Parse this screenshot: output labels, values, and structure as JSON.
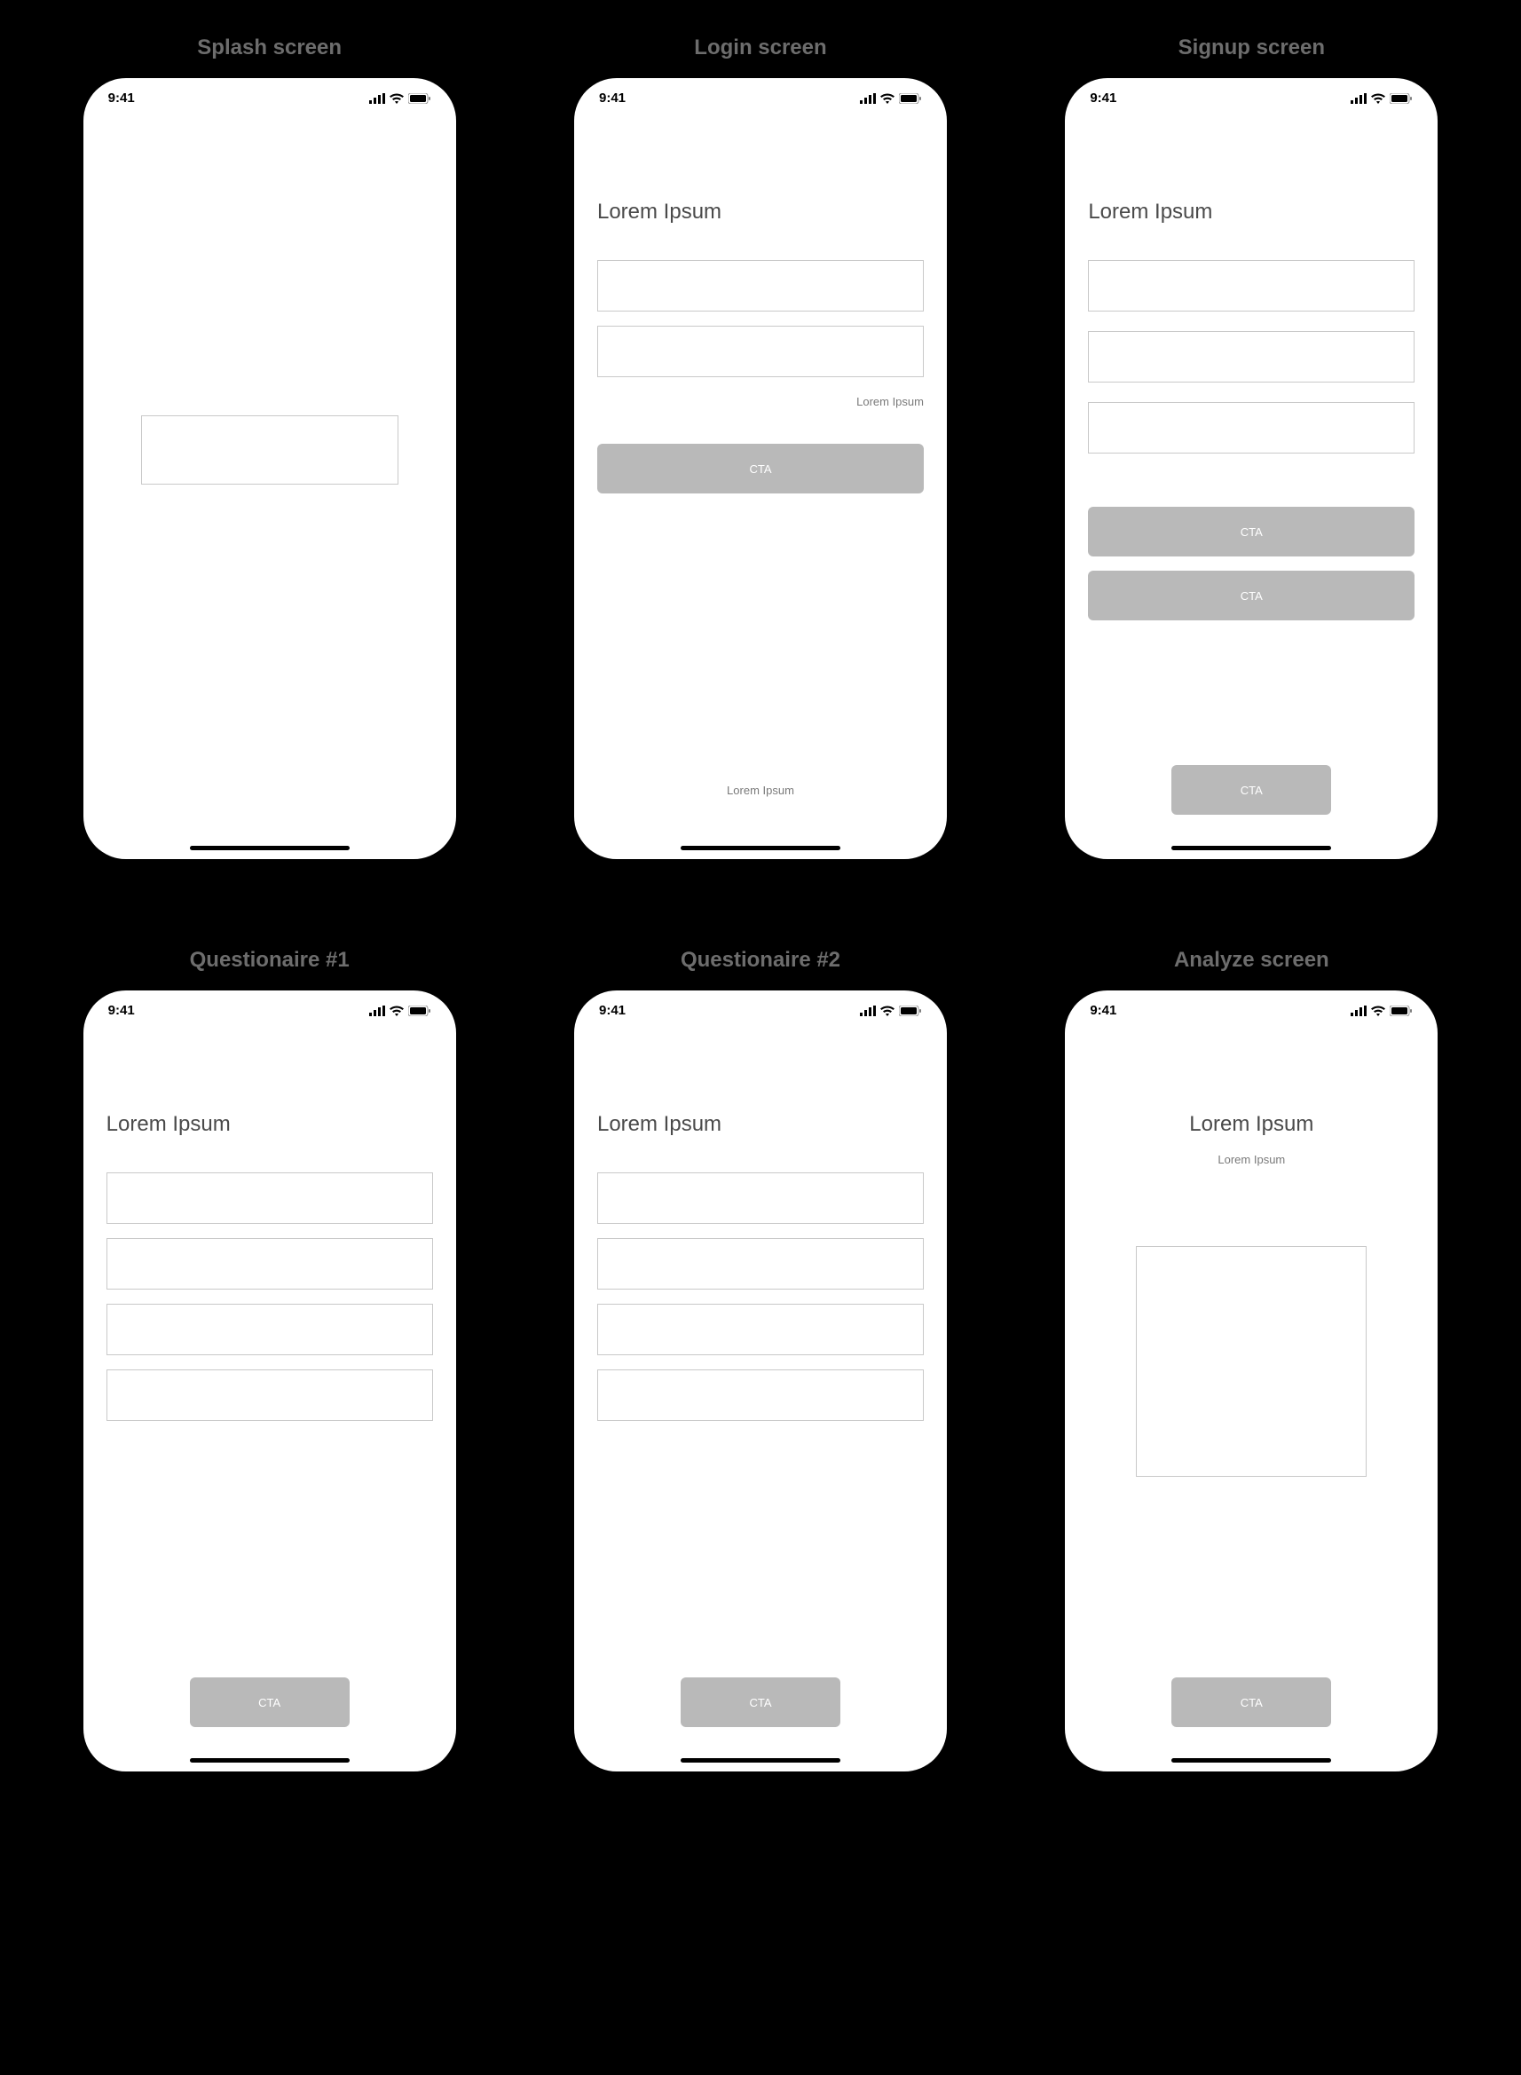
{
  "statusbar": {
    "time": "9:41"
  },
  "screens": [
    {
      "title": "Splash screen"
    },
    {
      "title": "Login screen",
      "heading": "Lorem Ipsum",
      "forgot_link": "Lorem Ipsum",
      "cta": "CTA",
      "footer_text": "Lorem Ipsum"
    },
    {
      "title": "Signup screen",
      "heading": "Lorem Ipsum",
      "cta1": "CTA",
      "cta2": "CTA",
      "cta_small": "CTA"
    },
    {
      "title": "Questionaire #1",
      "heading": "Lorem Ipsum",
      "cta": "CTA"
    },
    {
      "title": "Questionaire #2",
      "heading": "Lorem Ipsum",
      "cta": "CTA"
    },
    {
      "title": "Analyze screen",
      "heading": "Lorem Ipsum",
      "subtext": "Lorem Ipsum",
      "cta": "CTA"
    }
  ]
}
